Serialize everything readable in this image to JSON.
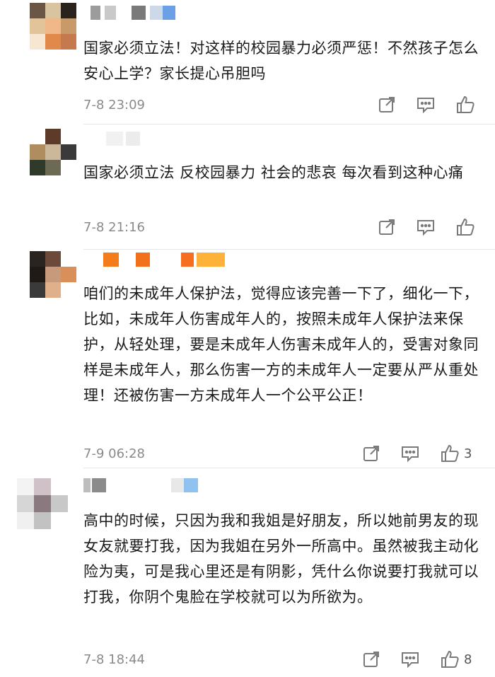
{
  "comments": [
    {
      "text": "国家必须立法！对这样的校园暴力必须严惩！不然孩子怎么安心上学？家长提心吊胆吗",
      "time": "7-8 23:09",
      "likes": ""
    },
    {
      "text": "国家必须立法  反校园暴力 社会的悲哀  每次看到这种心痛",
      "time": "7-8 21:16",
      "likes": ""
    },
    {
      "text": "咱们的未成年人保护法，觉得应该完善一下了，细化一下，比如，未成年人伤害成年人的，按照未成年人保护法来保护，从轻处理，要是未成年人伤害未成年人的，受害对象同样是未成年人，那么伤害一方的未成年人一定要从严从重处理！还被伤害一方未成年人一个公平公正！",
      "time": "7-9 06:28",
      "likes": "3"
    },
    {
      "text": "高中的时候，只因为我和我姐是好朋友，所以她前男友的现女友就要打我，因为我姐在另外一所高中。虽然被我主动化险为夷，可是我心里还是有阴影，凭什么你说要打我就可以打我，你阴个鬼脸在学校就可以为所欲为。",
      "time": "7-8 18:44",
      "likes": "8"
    }
  ],
  "icons": {
    "share": "share-icon",
    "reply": "comment-icon",
    "like": "thumbs-up-icon"
  },
  "colors": {
    "text": "#1a1a1a",
    "meta": "#8a8a8a",
    "icon": "#7a7a7a",
    "divider": "#e6e6e6"
  }
}
